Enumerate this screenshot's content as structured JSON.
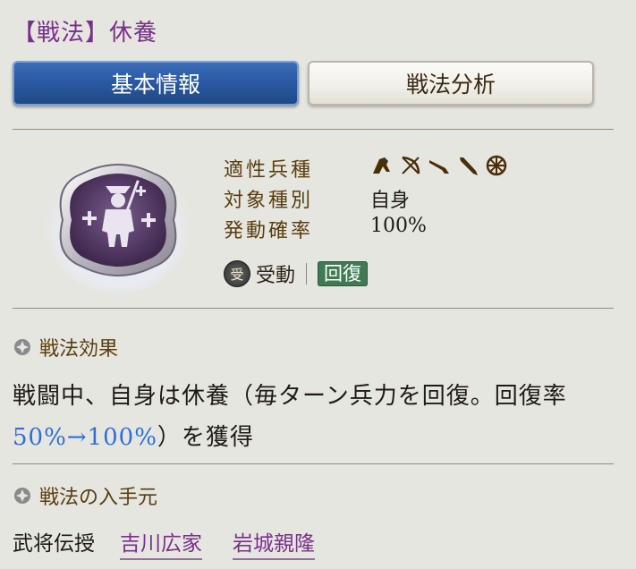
{
  "header": {
    "title": "【戦法】休養"
  },
  "tabs": [
    {
      "label": "基本情報",
      "active": true
    },
    {
      "label": "戦法分析",
      "active": false
    }
  ],
  "skill_icon": {
    "name": "skill-emblem-icon"
  },
  "stats": [
    {
      "label": "適性兵種",
      "value": ""
    },
    {
      "label": "対象種別",
      "value": "自身"
    },
    {
      "label": "発動確率",
      "value": "100%"
    }
  ],
  "troop_icons": [
    "cavalry-icon",
    "bow-icon",
    "gun-icon",
    "spear-icon",
    "siege-wheel-icon"
  ],
  "tags": {
    "passive_icon_glyph": "受",
    "passive_label": "受動",
    "type_label": "回復"
  },
  "effect": {
    "heading": "戦法効果",
    "text_before": "戦闘中、自身は休養（毎ターン兵力を回復。回復率",
    "highlight": "50%→100%",
    "text_after": "）を獲得"
  },
  "source": {
    "heading": "戦法の入手元",
    "label": "武将伝授",
    "links": [
      "吉川広家",
      "岩城親隆"
    ]
  },
  "colors": {
    "title": "#7a2f8a",
    "tab_active": "#2a5aa3",
    "highlight": "#2c6fd8",
    "heal_tag": "#3f7a52",
    "link": "#7a2f8a"
  }
}
